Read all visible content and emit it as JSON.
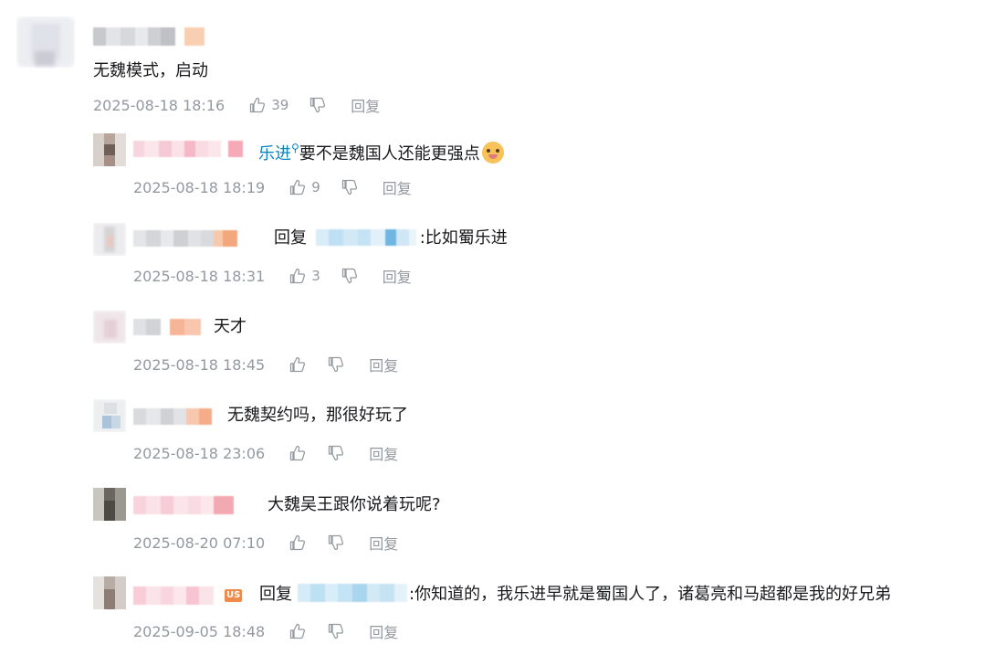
{
  "comments": [
    {
      "text": "无魏模式，启动",
      "time": "2025-08-18 18:16",
      "likes": "39",
      "reply_label": "回复"
    }
  ],
  "replies": [
    {
      "mention": "乐进",
      "text": "要不是魏国人还能更强点",
      "time": "2025-08-18 18:19",
      "likes": "9",
      "reply_label": "回复"
    },
    {
      "reply_prefix": "回复",
      "text": ":比如蜀乐进",
      "time": "2025-08-18 18:31",
      "likes": "3",
      "reply_label": "回复"
    },
    {
      "text": "天才",
      "time": "2025-08-18 18:45",
      "likes": "",
      "reply_label": "回复"
    },
    {
      "text": "无魏契约吗，那很好玩了",
      "time": "2025-08-18 23:06",
      "likes": "",
      "reply_label": "回复"
    },
    {
      "text": "大魏吴王跟你说着玩呢?",
      "time": "2025-08-20 07:10",
      "likes": "",
      "reply_label": "回复"
    },
    {
      "reply_prefix": "回复",
      "text": ":你知道的，我乐进早就是蜀国人了，诸葛亮和马超都是我的好兄弟",
      "time": "2025-09-05 18:48",
      "likes": "",
      "reply_label": "回复",
      "badge": "US"
    }
  ],
  "icons": {
    "like": "thumbs-up-icon",
    "dislike": "thumbs-down-icon",
    "emoji": "doge-emoji-icon",
    "search": "search-mark-icon"
  },
  "colors": {
    "text": "#18191c",
    "meta": "#9499a0",
    "link": "#0a84c1",
    "background": "#ffffff"
  }
}
